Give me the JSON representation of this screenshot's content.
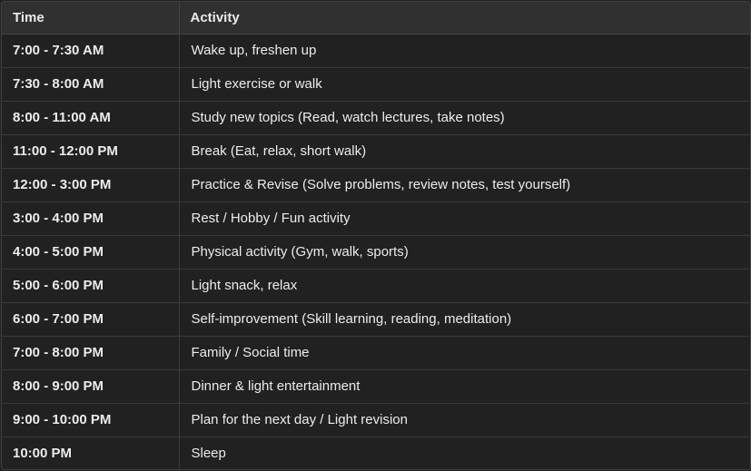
{
  "table": {
    "headers": {
      "time": "Time",
      "activity": "Activity"
    },
    "rows": [
      {
        "time": "7:00 - 7:30 AM",
        "activity": "Wake up, freshen up"
      },
      {
        "time": "7:30 - 8:00 AM",
        "activity": "Light exercise or walk"
      },
      {
        "time": "8:00 - 11:00 AM",
        "activity": "Study new topics (Read, watch lectures, take notes)"
      },
      {
        "time": "11:00 - 12:00 PM",
        "activity": "Break (Eat, relax, short walk)"
      },
      {
        "time": "12:00 - 3:00 PM",
        "activity": "Practice & Revise (Solve problems, review notes, test yourself)"
      },
      {
        "time": "3:00 - 4:00 PM",
        "activity": "Rest / Hobby / Fun activity"
      },
      {
        "time": "4:00 - 5:00 PM",
        "activity": "Physical activity (Gym, walk, sports)"
      },
      {
        "time": "5:00 - 6:00 PM",
        "activity": "Light snack, relax"
      },
      {
        "time": "6:00 - 7:00 PM",
        "activity": "Self-improvement (Skill learning, reading, meditation)"
      },
      {
        "time": "7:00 - 8:00 PM",
        "activity": "Family / Social time"
      },
      {
        "time": "8:00 - 9:00 PM",
        "activity": "Dinner & light entertainment"
      },
      {
        "time": "9:00 - 10:00 PM",
        "activity": "Plan for the next day / Light revision"
      },
      {
        "time": "10:00 PM",
        "activity": "Sleep"
      }
    ]
  },
  "colors": {
    "background": "#212121",
    "header_background": "#303030",
    "border": "#3f3f3f",
    "text": "#ececec"
  }
}
